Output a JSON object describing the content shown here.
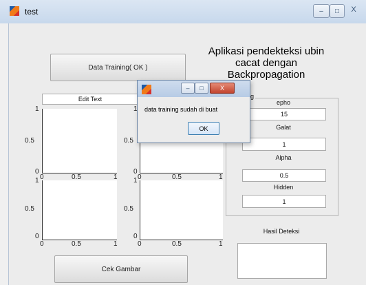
{
  "window": {
    "title": "test",
    "controls": [
      "–",
      "□",
      "X"
    ]
  },
  "app": {
    "title": "Aplikasi pendekteksi ubin cacat dengan Backpropagation",
    "btn_training": "Data Training( OK )",
    "edit_text": "Edit Text",
    "btn_cek": "Cek Gambar",
    "panel_label": "g",
    "epho_label": "epho",
    "epho_value": "15",
    "galat_label": "Galat",
    "galat_value": "1",
    "alpha_label": "Alpha",
    "alpha_value": "0.5",
    "hidden_label": "Hidden",
    "hidden_value": "1",
    "hasil_label": "Hasil Deteksi",
    "hasil_value": ""
  },
  "axes_ticks": {
    "y": [
      "1",
      "0.5",
      "0"
    ],
    "x": [
      "0",
      "0.5",
      "1"
    ]
  },
  "dialog": {
    "message": "data training sudah di buat",
    "ok": "OK",
    "controls": [
      "–",
      "□",
      "X"
    ]
  }
}
